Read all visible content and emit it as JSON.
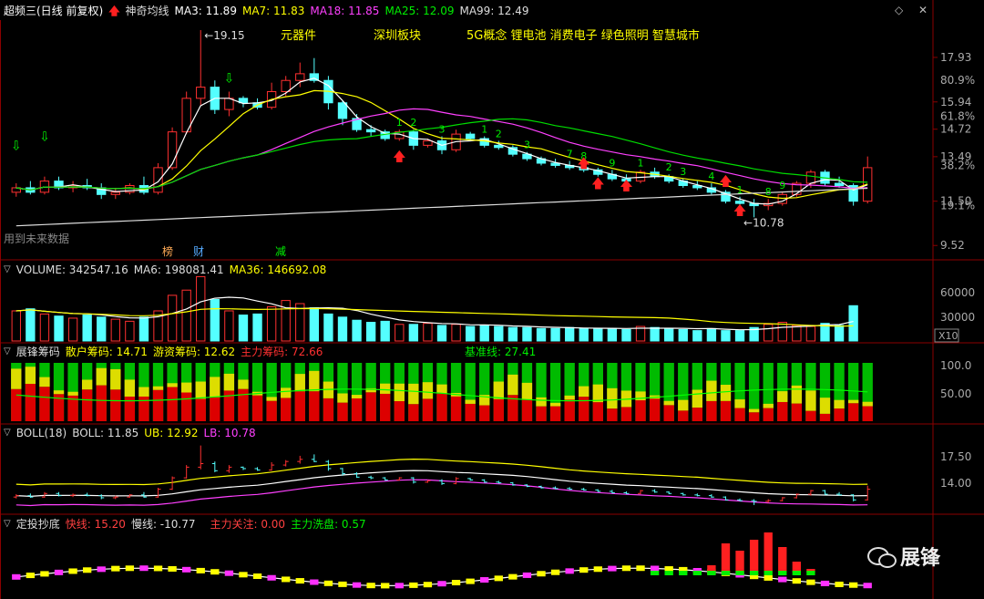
{
  "header": {
    "stock_name": "超频三(日线 前复权)",
    "indicator": "神奇均线",
    "ma3": "MA3: 11.89",
    "ma7": "MA7: 11.83",
    "ma18": "MA18: 11.85",
    "ma25": "MA25: 12.09",
    "ma99": "MA99: 12.49",
    "menu_icon": "diamond-icon",
    "close_icon": "close-icon"
  },
  "concepts": [
    "元器件",
    "深圳板块",
    "5G概念 锂电池 消费电子 绿色照明 智慧城市"
  ],
  "main_chart": {
    "price_axis": [
      "17.93",
      "15.94",
      "14.72",
      "13.49",
      "11.50",
      "9.52"
    ],
    "percent_axis": [
      "80.9%",
      "61.8%",
      "38.2%",
      "19.1%"
    ],
    "high_label": "19.15",
    "low_label": "10.78",
    "future_label": "用到未来数据",
    "event_labels": [
      "榜",
      "财",
      "减"
    ],
    "seq_labels": [
      "1",
      "2",
      "3",
      "1",
      "2",
      "3",
      "7",
      "8",
      "9",
      "1",
      "2",
      "3",
      "4",
      "1",
      "8",
      "9"
    ]
  },
  "volume_panel": {
    "name": "VOLUME: 342547.16",
    "ma6": "MA6: 198081.41",
    "ma36": "MA36: 146692.08",
    "axis": [
      "60000",
      "30000"
    ],
    "unit": "X10"
  },
  "chip_panel": {
    "name": "展锋筹码",
    "retail": "散户筹码: 14.71",
    "hot": "游资筹码: 12.62",
    "main": "主力筹码: 72.66",
    "base": "基准线: 27.41",
    "axis": [
      "100.0",
      "50.00"
    ]
  },
  "boll_panel": {
    "name": "BOLL(18)",
    "boll": "BOLL: 11.85",
    "ub": "UB: 12.92",
    "lb": "LB: 10.78",
    "axis": [
      "17.50",
      "14.00"
    ]
  },
  "invest_panel": {
    "name": "定投抄底",
    "fast": "快线: 15.20",
    "slow": "慢线: -10.77",
    "focus": "主力关注: 0.00",
    "wash": "主力洗盘: 0.57"
  },
  "watermark": {
    "icon": "wechat-icon",
    "text": "展锋"
  },
  "colors": {
    "up": "#ff3030",
    "down": "#54ffff",
    "ma3": "#ffffff",
    "ma7": "#ffff00",
    "ma18": "#ff40ff",
    "ma25": "#00dd00",
    "ma99": "#dddddd",
    "label": "#ffff00"
  },
  "chart_data": {
    "type": "candlestick",
    "title": "超频三(日线 前复权)",
    "candles": [
      {
        "o": 11.9,
        "h": 12.3,
        "l": 11.7,
        "c": 12.1
      },
      {
        "o": 12.1,
        "h": 12.4,
        "l": 11.8,
        "c": 11.9
      },
      {
        "o": 11.9,
        "h": 12.6,
        "l": 11.8,
        "c": 12.4
      },
      {
        "o": 12.4,
        "h": 12.6,
        "l": 12.0,
        "c": 12.1
      },
      {
        "o": 12.1,
        "h": 12.4,
        "l": 11.9,
        "c": 12.2
      },
      {
        "o": 12.2,
        "h": 12.5,
        "l": 12.0,
        "c": 12.1
      },
      {
        "o": 12.1,
        "h": 12.3,
        "l": 11.6,
        "c": 11.8
      },
      {
        "o": 11.8,
        "h": 12.1,
        "l": 11.6,
        "c": 11.9
      },
      {
        "o": 11.9,
        "h": 12.3,
        "l": 11.8,
        "c": 12.2
      },
      {
        "o": 12.2,
        "h": 12.6,
        "l": 11.8,
        "c": 11.9
      },
      {
        "o": 11.9,
        "h": 13.2,
        "l": 11.8,
        "c": 13.0
      },
      {
        "o": 13.0,
        "h": 14.8,
        "l": 12.9,
        "c": 14.6
      },
      {
        "o": 14.6,
        "h": 16.4,
        "l": 14.5,
        "c": 16.1
      },
      {
        "o": 16.1,
        "h": 19.15,
        "l": 15.8,
        "c": 16.6
      },
      {
        "o": 16.6,
        "h": 16.9,
        "l": 15.4,
        "c": 15.6
      },
      {
        "o": 15.6,
        "h": 16.4,
        "l": 15.3,
        "c": 16.1
      },
      {
        "o": 16.1,
        "h": 16.2,
        "l": 15.7,
        "c": 15.9
      },
      {
        "o": 15.9,
        "h": 16.1,
        "l": 15.6,
        "c": 15.7
      },
      {
        "o": 15.7,
        "h": 16.8,
        "l": 15.6,
        "c": 16.4
      },
      {
        "o": 16.4,
        "h": 17.1,
        "l": 16.2,
        "c": 16.9
      },
      {
        "o": 16.9,
        "h": 17.7,
        "l": 16.6,
        "c": 17.2
      },
      {
        "o": 17.2,
        "h": 17.9,
        "l": 16.8,
        "c": 16.9
      },
      {
        "o": 16.9,
        "h": 17.1,
        "l": 15.6,
        "c": 15.9
      },
      {
        "o": 15.9,
        "h": 16.0,
        "l": 14.9,
        "c": 15.2
      },
      {
        "o": 15.2,
        "h": 15.4,
        "l": 14.6,
        "c": 14.7
      },
      {
        "o": 14.7,
        "h": 14.9,
        "l": 14.4,
        "c": 14.6
      },
      {
        "o": 14.6,
        "h": 14.7,
        "l": 14.2,
        "c": 14.3
      },
      {
        "o": 14.3,
        "h": 14.7,
        "l": 14.2,
        "c": 14.6
      },
      {
        "o": 14.6,
        "h": 14.7,
        "l": 13.8,
        "c": 14.0
      },
      {
        "o": 14.0,
        "h": 14.3,
        "l": 13.9,
        "c": 14.2
      },
      {
        "o": 14.2,
        "h": 14.4,
        "l": 13.6,
        "c": 13.8
      },
      {
        "o": 13.8,
        "h": 14.7,
        "l": 13.7,
        "c": 14.5
      },
      {
        "o": 14.5,
        "h": 14.6,
        "l": 14.2,
        "c": 14.3
      },
      {
        "o": 14.3,
        "h": 14.4,
        "l": 13.9,
        "c": 14.0
      },
      {
        "o": 14.0,
        "h": 14.2,
        "l": 13.8,
        "c": 13.9
      },
      {
        "o": 13.9,
        "h": 14.0,
        "l": 13.5,
        "c": 13.6
      },
      {
        "o": 13.6,
        "h": 13.7,
        "l": 13.3,
        "c": 13.4
      },
      {
        "o": 13.4,
        "h": 13.5,
        "l": 13.1,
        "c": 13.2
      },
      {
        "o": 13.2,
        "h": 13.4,
        "l": 13.0,
        "c": 13.1
      },
      {
        "o": 13.1,
        "h": 13.3,
        "l": 12.9,
        "c": 13.0
      },
      {
        "o": 13.0,
        "h": 13.2,
        "l": 12.8,
        "c": 12.9
      },
      {
        "o": 12.9,
        "h": 13.0,
        "l": 12.6,
        "c": 12.7
      },
      {
        "o": 12.7,
        "h": 12.9,
        "l": 12.4,
        "c": 12.5
      },
      {
        "o": 12.5,
        "h": 12.7,
        "l": 12.3,
        "c": 12.4
      },
      {
        "o": 12.4,
        "h": 12.9,
        "l": 12.3,
        "c": 12.8
      },
      {
        "o": 12.8,
        "h": 13.0,
        "l": 12.5,
        "c": 12.6
      },
      {
        "o": 12.6,
        "h": 12.7,
        "l": 12.3,
        "c": 12.4
      },
      {
        "o": 12.4,
        "h": 12.5,
        "l": 12.1,
        "c": 12.2
      },
      {
        "o": 12.2,
        "h": 12.4,
        "l": 12.0,
        "c": 12.1
      },
      {
        "o": 12.1,
        "h": 12.3,
        "l": 11.8,
        "c": 11.9
      },
      {
        "o": 11.9,
        "h": 12.0,
        "l": 11.4,
        "c": 11.5
      },
      {
        "o": 11.5,
        "h": 11.7,
        "l": 11.3,
        "c": 11.4
      },
      {
        "o": 11.4,
        "h": 11.6,
        "l": 10.78,
        "c": 11.3
      },
      {
        "o": 11.3,
        "h": 11.6,
        "l": 11.1,
        "c": 11.4
      },
      {
        "o": 11.4,
        "h": 11.9,
        "l": 11.3,
        "c": 11.8
      },
      {
        "o": 11.8,
        "h": 12.4,
        "l": 11.7,
        "c": 12.3
      },
      {
        "o": 12.3,
        "h": 12.9,
        "l": 12.1,
        "c": 12.8
      },
      {
        "o": 12.8,
        "h": 12.9,
        "l": 12.2,
        "c": 12.3
      },
      {
        "o": 12.3,
        "h": 12.6,
        "l": 12.1,
        "c": 12.2
      },
      {
        "o": 12.2,
        "h": 12.3,
        "l": 11.3,
        "c": 11.5
      },
      {
        "o": 11.5,
        "h": 13.5,
        "l": 11.4,
        "c": 13.0
      }
    ],
    "volume": [
      2.9,
      3.1,
      2.6,
      2.4,
      2.2,
      2.5,
      2.3,
      2.1,
      1.9,
      2.3,
      2.9,
      4.4,
      4.9,
      6.2,
      4.0,
      2.9,
      2.5,
      2.6,
      3.3,
      3.9,
      3.6,
      3.2,
      2.6,
      2.3,
      2.0,
      1.8,
      1.9,
      1.6,
      1.6,
      1.7,
      1.5,
      1.6,
      1.4,
      1.5,
      1.4,
      1.3,
      1.3,
      1.2,
      1.2,
      1.3,
      1.2,
      1.2,
      1.2,
      1.1,
      1.4,
      1.3,
      1.2,
      1.1,
      1.0,
      1.2,
      1.0,
      1.0,
      1.3,
      1.6,
      1.8,
      1.5,
      1.4,
      1.7,
      1.5,
      3.4
    ],
    "price_axis_range": [
      9.52,
      19.15
    ]
  }
}
